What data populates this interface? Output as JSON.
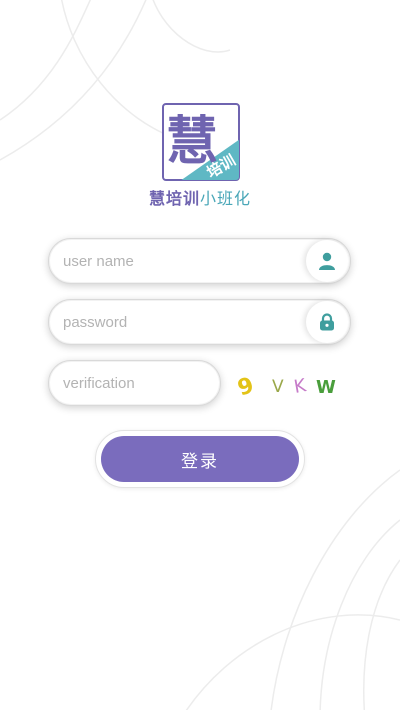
{
  "app": {
    "logo_glyph": "慧",
    "logo_badge": "培训",
    "brand_bold": "慧培训",
    "brand_light": "小班化"
  },
  "form": {
    "username": {
      "value": "",
      "placeholder": "user name"
    },
    "password": {
      "value": "",
      "placeholder": "password"
    },
    "verification": {
      "value": "",
      "placeholder": "verification"
    }
  },
  "captcha": {
    "chars": [
      "9",
      "V",
      "K",
      "W"
    ],
    "colors": [
      "#e3c317",
      "#9aa84a",
      "#c67bc9",
      "#4a9e3c"
    ]
  },
  "login_button": {
    "label": "登录"
  },
  "colors": {
    "primary": "#7a6cbd",
    "teal": "#4aa7b8",
    "icon_teal": "#3f9e9e"
  },
  "icons": {
    "user": "user-icon",
    "password": "lock-icon"
  }
}
